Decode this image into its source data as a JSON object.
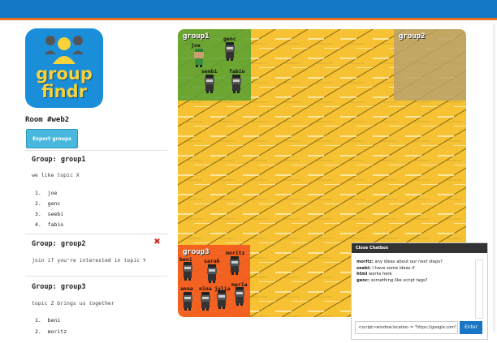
{
  "app": {
    "logo_line1": "group",
    "logo_line2": "findr",
    "room": "Room #web2",
    "export_button": "Export groups",
    "brand_color": "#1a8ed9",
    "accent_color": "#e8731e"
  },
  "groups": [
    {
      "name": "Group: group1",
      "description": "we like topic X",
      "members": [
        "joe",
        "genc",
        "seebi",
        "fabio"
      ],
      "removable": false
    },
    {
      "name": "Group: group2",
      "description": "join if you're interested in topic Y",
      "members": [],
      "removable": true
    },
    {
      "name": "Group: group3",
      "description": "topic Z brings us together",
      "members": [
        "beni",
        "moritz"
      ],
      "removable": false
    }
  ],
  "map": {
    "zones": [
      {
        "label": "group1",
        "color": "#5aa032"
      },
      {
        "label": "group2",
        "color": "#b8a16a"
      },
      {
        "label": "group3",
        "color": "#f25a1e"
      }
    ],
    "avatars": {
      "joe": "joe",
      "genc": "genc",
      "seebi": "seebi",
      "fabio": "fabio",
      "beni": "beni",
      "sarah": "sarah",
      "moritz": "moritz",
      "anna": "anna",
      "nina": "nina",
      "julia": "julia",
      "maria": "maria"
    }
  },
  "chat": {
    "title": "Close Chatbox",
    "messages": [
      {
        "user": "moritz:",
        "text": "any ideas about our next steps?"
      },
      {
        "user": "seebi:",
        "text": "I have some ideas if"
      },
      {
        "user": "html",
        "text": "works here"
      },
      {
        "user": "genc:",
        "text": "something like script tags?"
      }
    ],
    "input_value": "<script>window.location = \"https://google.com\";</scr",
    "enter_label": "Enter"
  }
}
